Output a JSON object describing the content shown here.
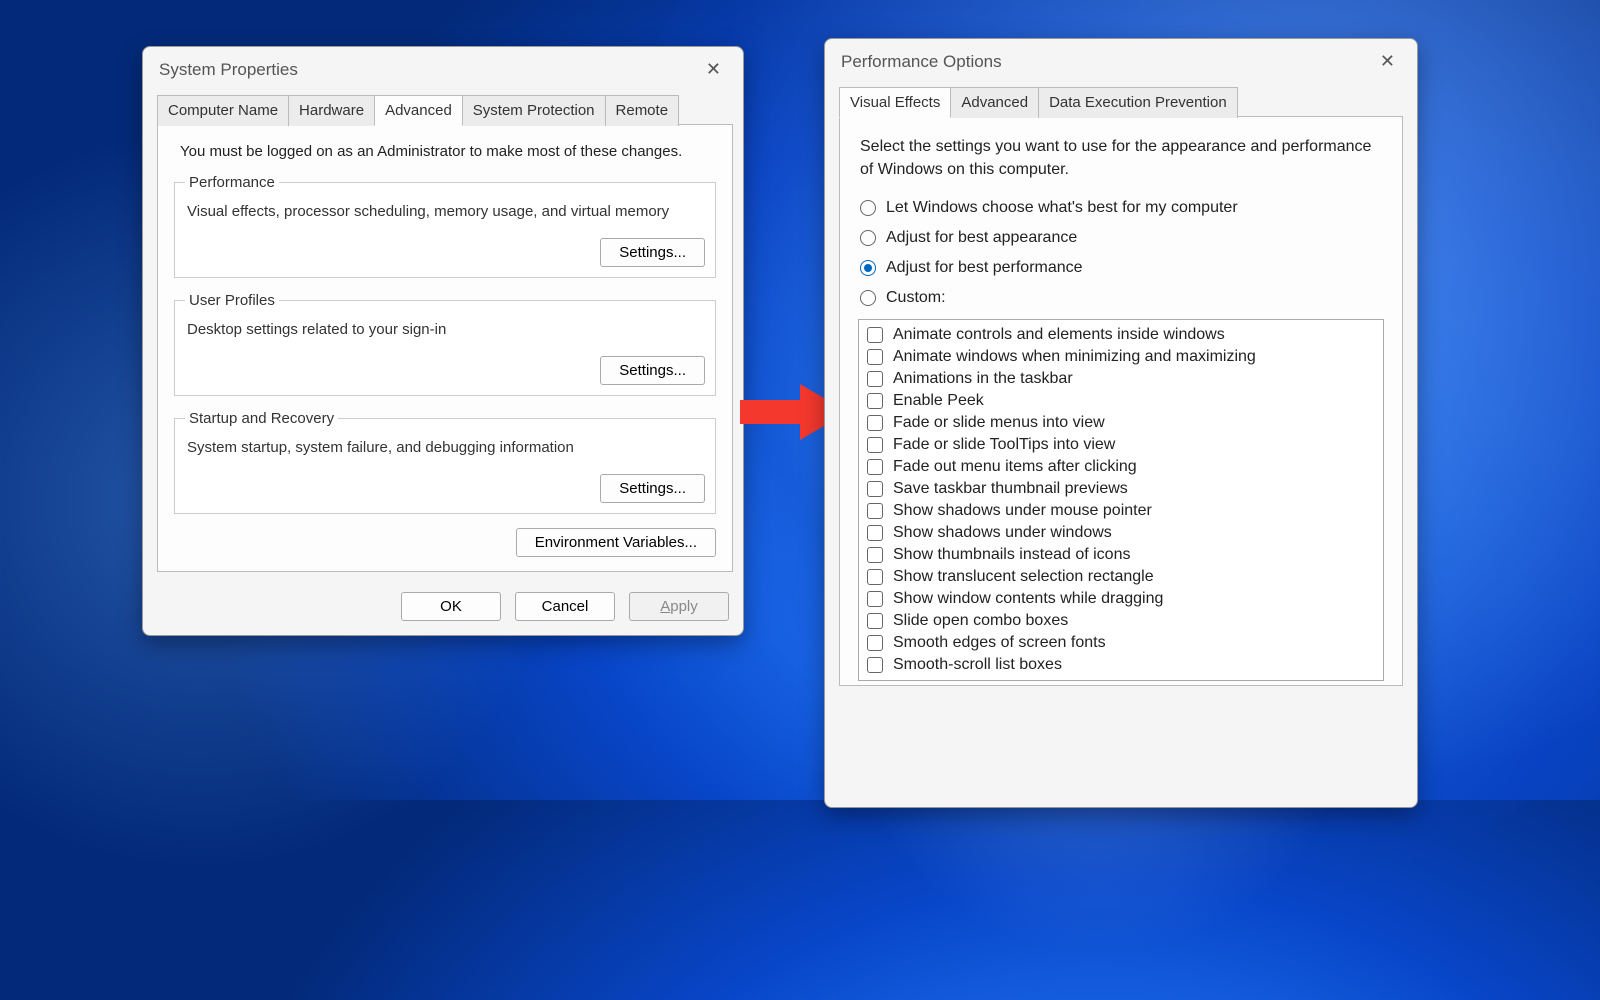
{
  "sysprops": {
    "title": "System Properties",
    "tabs": [
      "Computer Name",
      "Hardware",
      "Advanced",
      "System Protection",
      "Remote"
    ],
    "active_tab": 2,
    "intro": "You must be logged on as an Administrator to make most of these changes.",
    "groups": {
      "performance": {
        "legend": "Performance",
        "desc": "Visual effects, processor scheduling, memory usage, and virtual memory",
        "button": "Settings..."
      },
      "userprofiles": {
        "legend": "User Profiles",
        "desc": "Desktop settings related to your sign-in",
        "button": "Settings..."
      },
      "startup": {
        "legend": "Startup and Recovery",
        "desc": "System startup, system failure, and debugging information",
        "button": "Settings..."
      }
    },
    "env_button": "Environment Variables...",
    "buttons": {
      "ok": "OK",
      "cancel": "Cancel",
      "apply": "Apply",
      "apply_key": "A"
    }
  },
  "perfopts": {
    "title": "Performance Options",
    "tabs": [
      "Visual Effects",
      "Advanced",
      "Data Execution Prevention"
    ],
    "active_tab": 0,
    "desc": "Select the settings you want to use for the appearance and performance of Windows on this computer.",
    "radios": [
      {
        "label": "Let Windows choose what's best for my computer",
        "checked": false
      },
      {
        "label": "Adjust for best appearance",
        "checked": false
      },
      {
        "label": "Adjust for best performance",
        "checked": true
      },
      {
        "label": "Custom:",
        "checked": false
      }
    ],
    "checks": [
      "Animate controls and elements inside windows",
      "Animate windows when minimizing and maximizing",
      "Animations in the taskbar",
      "Enable Peek",
      "Fade or slide menus into view",
      "Fade or slide ToolTips into view",
      "Fade out menu items after clicking",
      "Save taskbar thumbnail previews",
      "Show shadows under mouse pointer",
      "Show shadows under windows",
      "Show thumbnails instead of icons",
      "Show translucent selection rectangle",
      "Show window contents while dragging",
      "Slide open combo boxes",
      "Smooth edges of screen fonts",
      "Smooth-scroll list boxes"
    ]
  }
}
